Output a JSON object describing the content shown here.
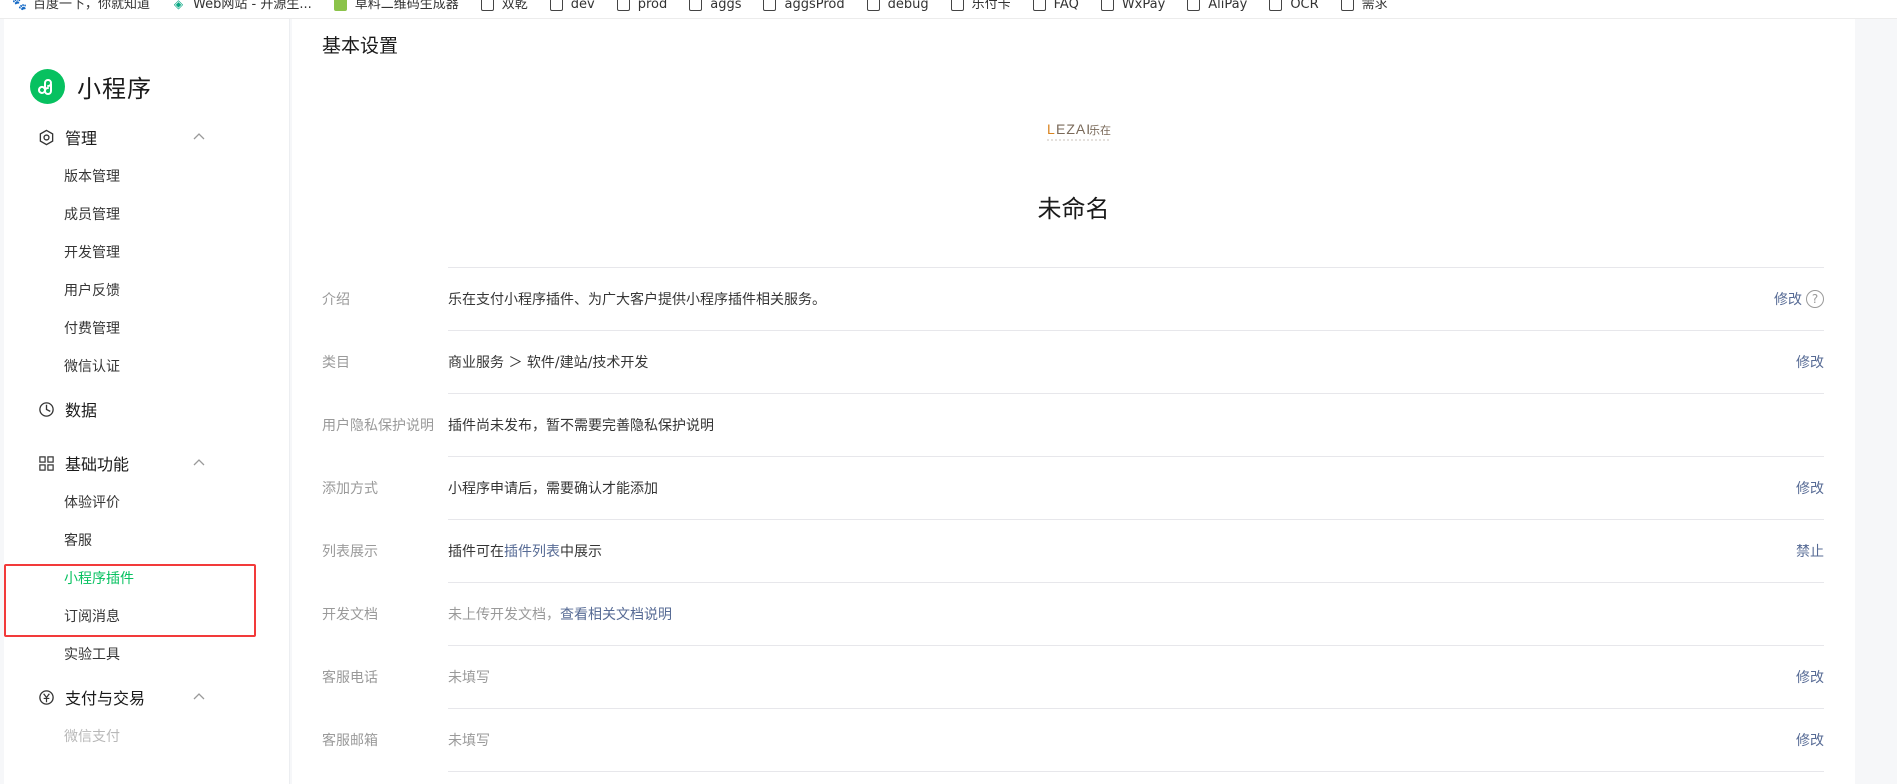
{
  "bookmarks": [
    {
      "icon": "baidu-icon",
      "label": "百度一下，你就知道"
    },
    {
      "icon": "web-icon",
      "label": "Web网站 - 开源生..."
    },
    {
      "icon": "qrcode-icon",
      "label": "草料二维码生成器"
    },
    {
      "icon": "folder-icon",
      "label": "双乾"
    },
    {
      "icon": "folder-icon",
      "label": "dev"
    },
    {
      "icon": "folder-icon",
      "label": "prod"
    },
    {
      "icon": "folder-icon",
      "label": "aggs"
    },
    {
      "icon": "folder-icon",
      "label": "aggsProd"
    },
    {
      "icon": "folder-icon",
      "label": "debug"
    },
    {
      "icon": "folder-icon",
      "label": "乐付卡"
    },
    {
      "icon": "folder-icon",
      "label": "FAQ"
    },
    {
      "icon": "folder-icon",
      "label": "WxPay"
    },
    {
      "icon": "folder-icon",
      "label": "AliPay"
    },
    {
      "icon": "folder-icon",
      "label": "OCR"
    },
    {
      "icon": "folder-icon",
      "label": "需求"
    }
  ],
  "sidebar": {
    "brand": "小程序",
    "sections": {
      "manage": {
        "title": "管理",
        "icon": "hexagon-settings-icon",
        "items": [
          "版本管理",
          "成员管理",
          "开发管理",
          "用户反馈",
          "付费管理",
          "微信认证"
        ]
      },
      "data": {
        "title": "数据",
        "icon": "pie-chart-icon"
      },
      "basic": {
        "title": "基础功能",
        "icon": "grid-apps-icon",
        "items": [
          "体验评价",
          "客服",
          "小程序插件",
          "订阅消息",
          "实验工具"
        ]
      },
      "pay": {
        "title": "支付与交易",
        "icon": "yen-circle-icon",
        "items": [
          "微信支付"
        ]
      }
    },
    "active_item": "小程序插件"
  },
  "main": {
    "page_title": "基本设置",
    "plugin_logo_text": "LEZAI 乐在",
    "plugin_name": "未命名",
    "rows": [
      {
        "label": "介绍",
        "value": "乐在支付小程序插件、为广大客户提供小程序插件相关服务。",
        "action": "修改"
      },
      {
        "label": "类目",
        "value": "商业服务 ＞ 软件/建站/技术开发",
        "action": "修改"
      },
      {
        "label": "用户隐私保护说明",
        "value": "插件尚未发布，暂不需要完善隐私保护说明"
      },
      {
        "label": "添加方式",
        "value": "小程序申请后，需要确认才能添加",
        "action": "修改"
      },
      {
        "label": "列表展示",
        "value_prefix": "插件可在",
        "value_link": "插件列表",
        "value_suffix": "中展示",
        "action": "禁止"
      },
      {
        "label": "开发文档",
        "value": "未上传开发文档，",
        "value_link": "查看相关文档说明"
      },
      {
        "label": "客服电话",
        "value": "未填写",
        "action": "修改"
      },
      {
        "label": "客服邮箱",
        "value": "未填写",
        "action": "修改"
      }
    ]
  },
  "colors": {
    "accent": "#07c160",
    "link": "#576b95",
    "highlight": "#f23a3a"
  }
}
